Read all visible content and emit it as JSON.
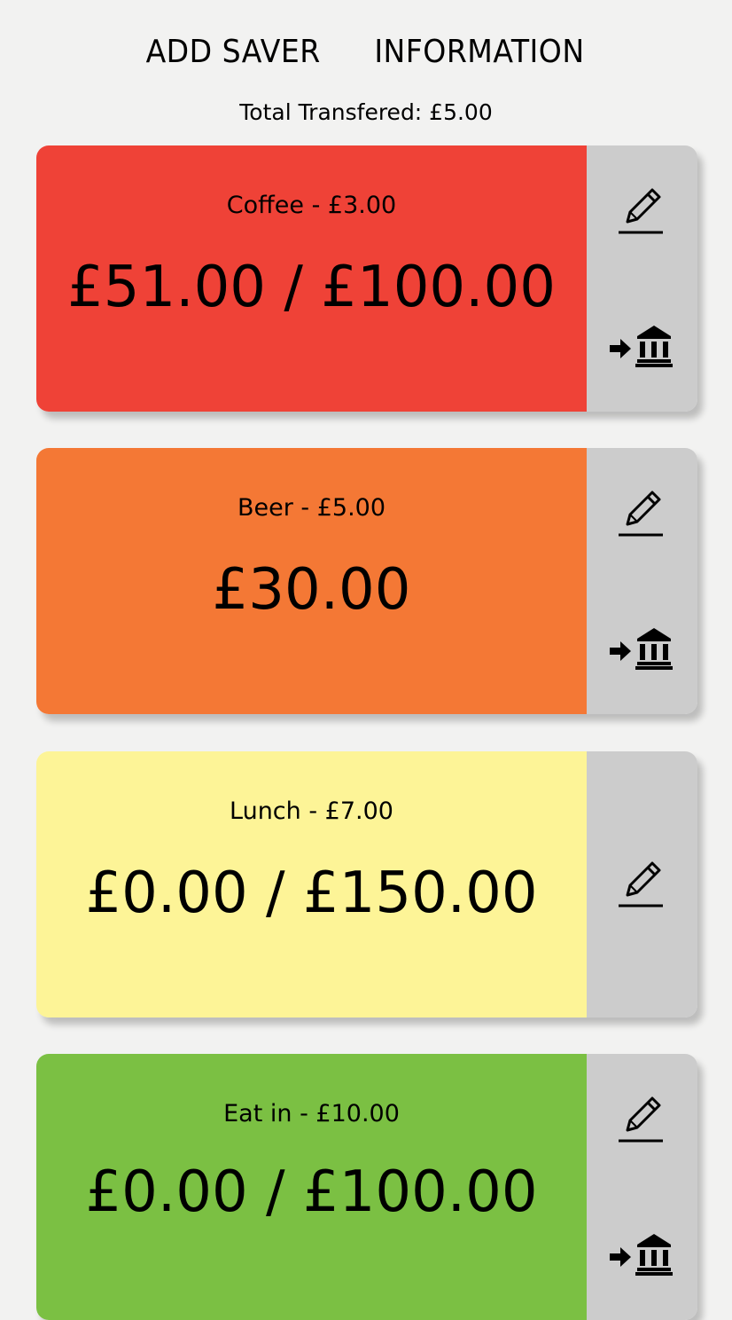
{
  "nav": {
    "add_saver": "ADD SAVER",
    "information": "INFORMATION"
  },
  "total": {
    "text": "Total Transfered: £5.00"
  },
  "savers": [
    {
      "label": "Coffee - £3.00",
      "amount": "£51.00 / £100.00",
      "color": "#ef4237",
      "icons": [
        "pencil-icon",
        "bank-transfer-icon"
      ]
    },
    {
      "label": "Beer - £5.00",
      "amount": "£30.00",
      "color": "#f47835",
      "icons": [
        "pencil-icon",
        "bank-transfer-icon"
      ]
    },
    {
      "label": "Lunch - £7.00",
      "amount": "£0.00 / £150.00",
      "color": "#fdf497",
      "icons": [
        "pencil-icon"
      ]
    },
    {
      "label": "Eat in - £10.00",
      "amount": "£0.00 / £100.00",
      "color": "#7bc043",
      "icons": [
        "pencil-icon",
        "bank-transfer-icon"
      ]
    }
  ]
}
